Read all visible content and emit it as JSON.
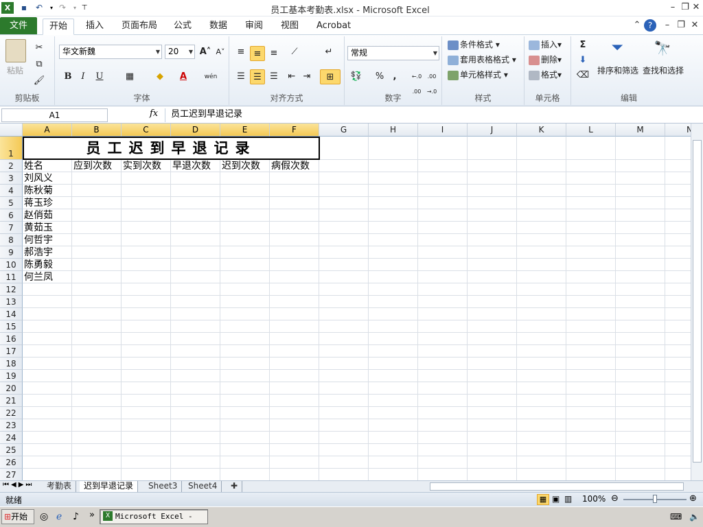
{
  "window": {
    "title": "员工基本考勤表.xlsx - Microsoft Excel"
  },
  "ribbon_tabs": [
    "文件",
    "开始",
    "插入",
    "页面布局",
    "公式",
    "数据",
    "审阅",
    "视图",
    "Acrobat"
  ],
  "ribbon": {
    "clipboard": {
      "paste": "粘贴",
      "group": "剪贴板"
    },
    "font": {
      "name": "华文新魏",
      "size": "20",
      "group": "字体",
      "bold": "B",
      "italic": "I",
      "underline": "U",
      "font_color_glyph": "A",
      "wen": "wén"
    },
    "alignment": {
      "group": "对齐方式"
    },
    "number": {
      "format": "常规",
      "group": "数字",
      "percent": "%",
      "comma": ",",
      "inc": "←.0 .00",
      "dec": ".00 →.0"
    },
    "styles": {
      "conditional": "条件格式",
      "table_format": "套用表格格式",
      "cell_styles": "单元格样式",
      "group": "样式"
    },
    "cells": {
      "insert": "插入",
      "delete": "删除",
      "format": "格式",
      "group": "单元格"
    },
    "editing": {
      "sigma": "Σ",
      "sort_filter": "排序和筛选",
      "find_select": "查找和选择",
      "group": "编辑"
    }
  },
  "formula_bar": {
    "name_box": "A1",
    "fx": "fx",
    "content": "员工迟到早退记录"
  },
  "sheet": {
    "columns": [
      "A",
      "B",
      "C",
      "D",
      "E",
      "F",
      "G",
      "H",
      "I",
      "J",
      "K",
      "L",
      "M",
      "N"
    ],
    "rows": [
      "1",
      "2",
      "3",
      "4",
      "5",
      "6",
      "7",
      "8",
      "9",
      "10",
      "11",
      "12",
      "13",
      "14",
      "15",
      "16",
      "17",
      "18",
      "19",
      "20",
      "21",
      "22",
      "23",
      "24",
      "25",
      "26",
      "27"
    ],
    "title": "员工迟到早退记录",
    "headers": [
      "姓名",
      "应到次数",
      "实到次数",
      "早退次数",
      "迟到次数",
      "病假次数"
    ],
    "names": [
      "刘风义",
      "陈秋菊",
      "蒋玉珍",
      "赵俏茹",
      "黄茹玉",
      "何哲宇",
      "郝浩宇",
      "陈勇毅",
      "何兰凤"
    ]
  },
  "sheet_tabs": [
    "考勤表",
    "迟到早退记录",
    "Sheet3",
    "Sheet4"
  ],
  "status": {
    "ready": "就绪",
    "zoom": "100%"
  },
  "taskbar": {
    "start": "开始",
    "item": "Microsoft Excel - ...",
    "more": "»"
  }
}
